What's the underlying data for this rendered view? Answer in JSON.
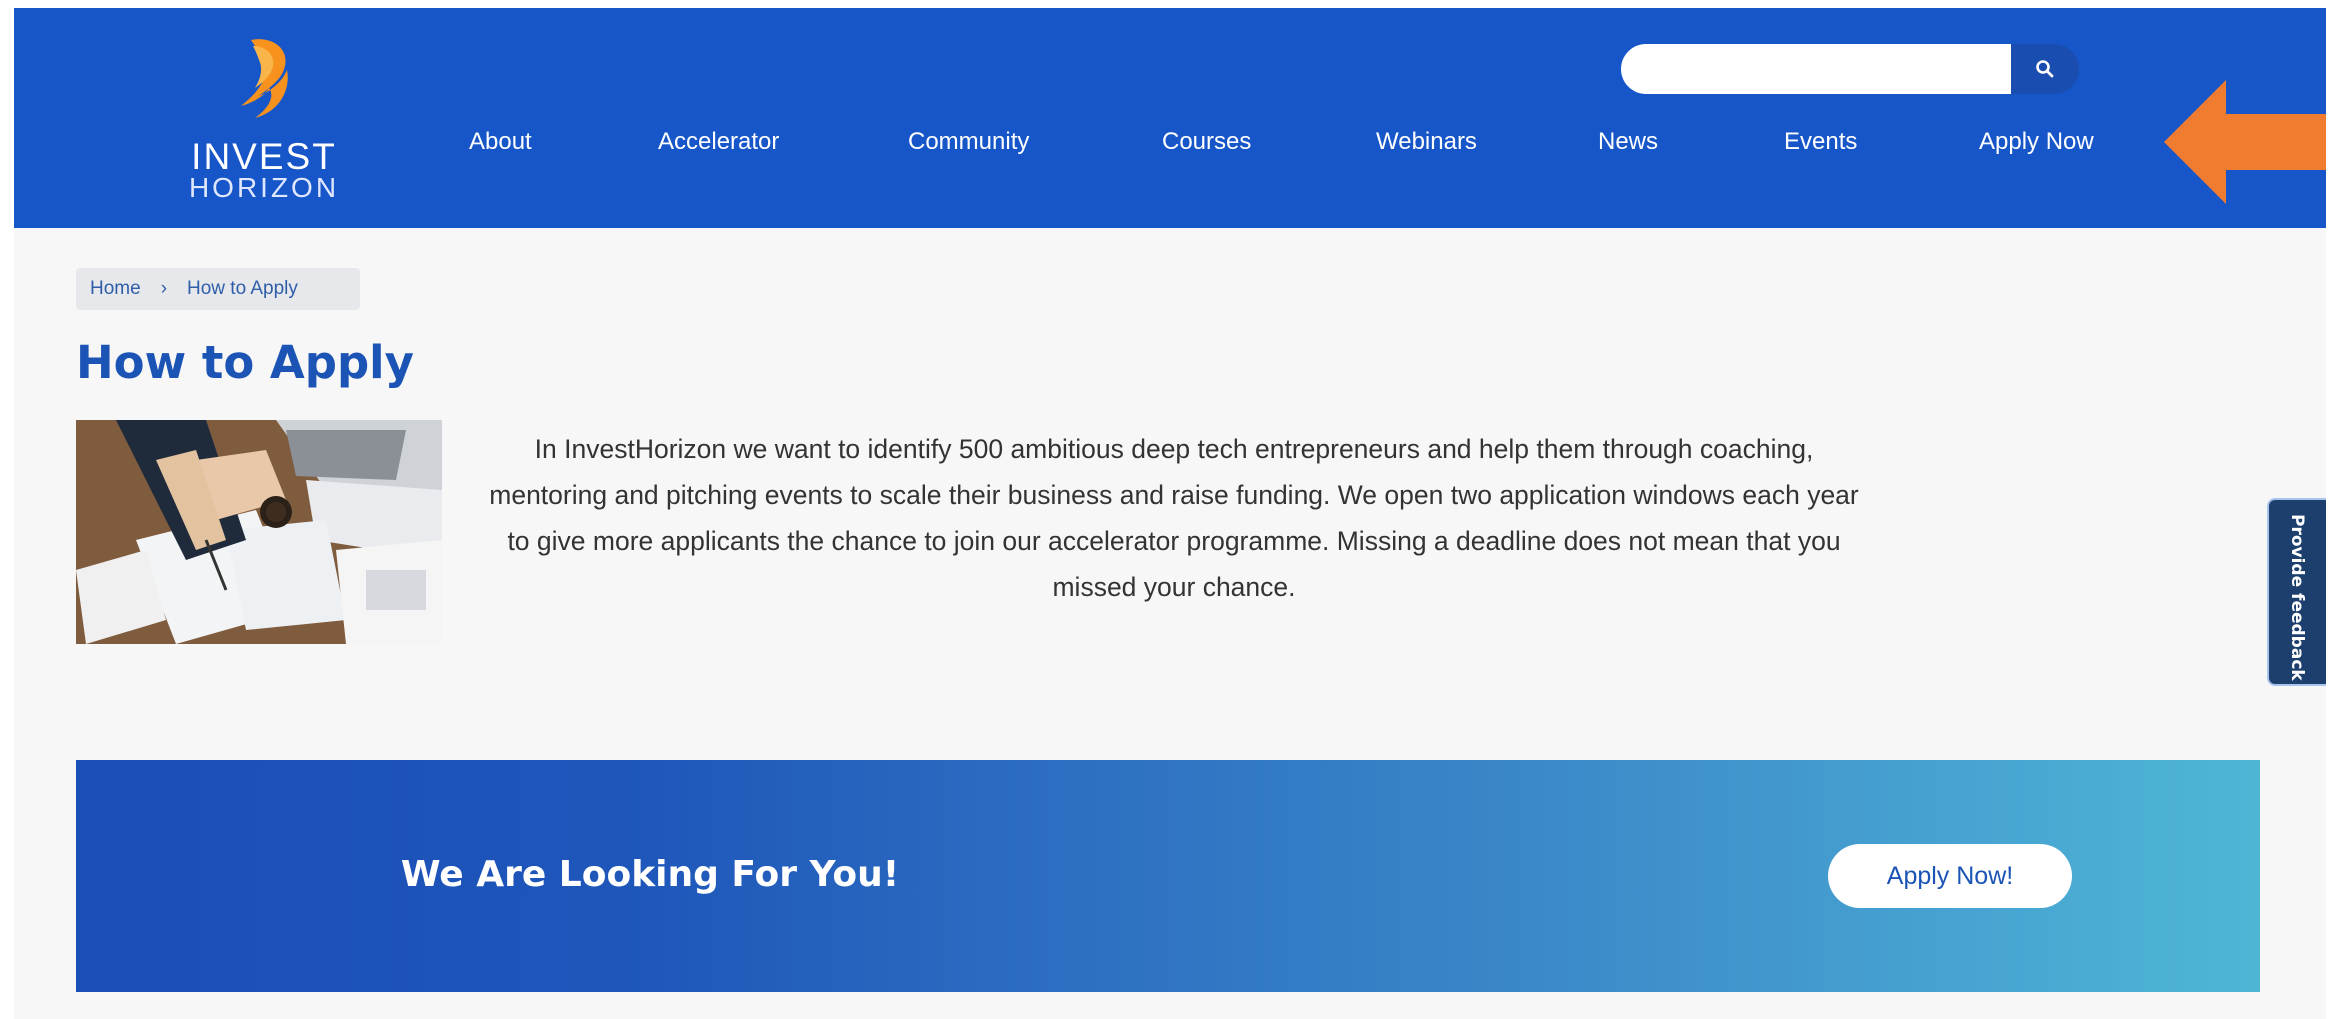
{
  "header": {
    "logo": {
      "line1": "INVEST",
      "line2": "HORIZON"
    },
    "search": {
      "placeholder": "",
      "value": ""
    },
    "nav": [
      {
        "label": "About"
      },
      {
        "label": "Accelerator"
      },
      {
        "label": "Community"
      },
      {
        "label": "Courses"
      },
      {
        "label": "Webinars"
      },
      {
        "label": "News"
      },
      {
        "label": "Events"
      },
      {
        "label": "Apply Now"
      }
    ]
  },
  "breadcrumb": {
    "home": "Home",
    "separator": "›",
    "current": "How to Apply"
  },
  "main": {
    "title": "How to Apply",
    "intro": "In InvestHorizon we want to identify 500 ambitious deep tech entrepreneurs and help them through coaching, mentoring and pitching events to scale their business and raise funding. We open two application windows each year to give more applicants the chance to join our accelerator programme. Missing a deadline does not mean that you missed your chance."
  },
  "feedback": {
    "label": "Provide feedback"
  },
  "banner": {
    "title": "We Are Looking For You!",
    "button": "Apply Now!"
  },
  "colors": {
    "header_bg": "#1656c8",
    "title": "#1c54b5",
    "annotation_arrow": "#f07c30",
    "feedback_tab": "#1c3f6e"
  }
}
